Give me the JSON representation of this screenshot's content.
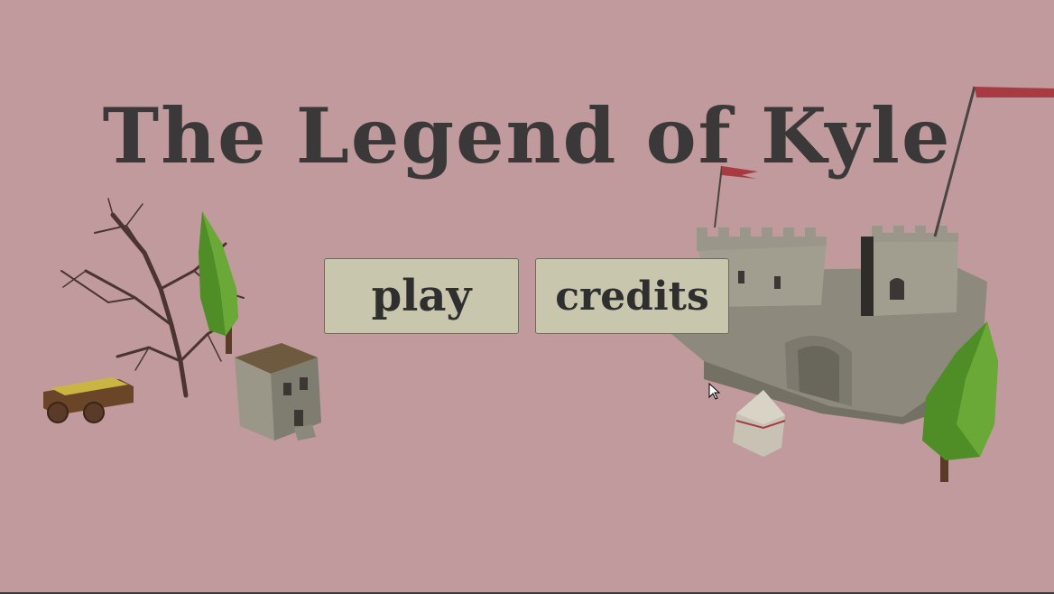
{
  "title": "The Legend of Kyle",
  "menu": {
    "play_label": "play",
    "credits_label": "credits"
  },
  "colors": {
    "background": "#c09a9c",
    "title": "#3a3838",
    "button_face": "#c9c6ae",
    "button_text": "#2f2f2f",
    "stone": "#8f8c7e",
    "foliage": "#5f9a2e",
    "banner": "#a83b42"
  }
}
